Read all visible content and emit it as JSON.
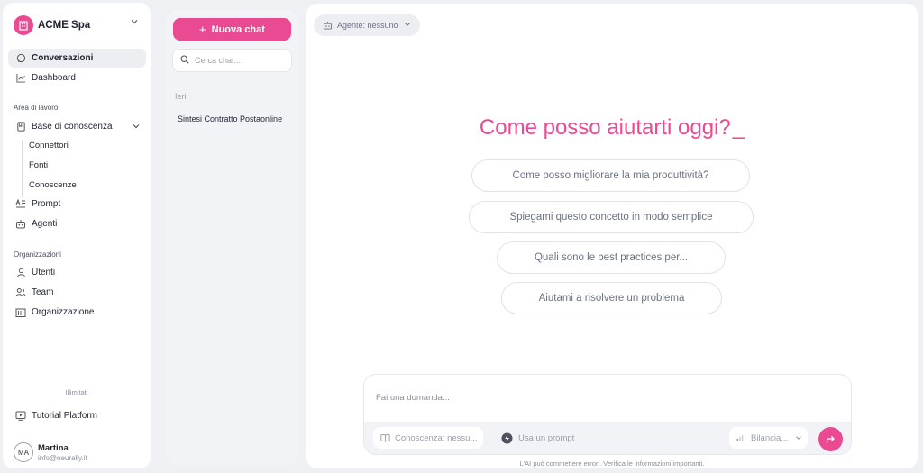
{
  "sidebar": {
    "org_name": "ACME Spa",
    "items": [
      {
        "label": "Conversazioni",
        "icon": "chat-icon"
      },
      {
        "label": "Dashboard",
        "icon": "chart-line-icon"
      }
    ],
    "workspace_section": "Area di lavoro",
    "knowledge": {
      "label": "Base di conoscenza",
      "children": [
        "Connettori",
        "Fonti",
        "Conoscenze"
      ]
    },
    "prompt_label": "Prompt",
    "agents_label": "Agenti",
    "org_section": "Organizzazioni",
    "org_items": [
      "Utenti",
      "Team",
      "Organizzazione"
    ],
    "plan": "Illimitati",
    "tutorial_label": "Tutorial Platform",
    "user": {
      "initials": "MA",
      "name": "Martina",
      "email": "info@neurally.it"
    }
  },
  "chatlist": {
    "new_chat_label": "Nuova chat",
    "search_placeholder": "Cerca chat...",
    "group_label": "Ieri",
    "chats": [
      "Sintesi Contratto Postaonline"
    ]
  },
  "main": {
    "agent_selector": "Agente: nessuno",
    "heading": "Come posso aiutarti oggi?",
    "cursor": "_",
    "suggestions": [
      "Come posso migliorare la mia produttività?",
      "Spiegami questo concetto in modo semplice",
      "Quali sono le best practices per...",
      "Aiutami a risolvere un problema"
    ],
    "composer": {
      "placeholder": "Fai una domanda...",
      "knowledge_chip": "Conoscenza: nessu...",
      "prompt_chip": "Usa un prompt",
      "mode_select": "Bilancia...",
      "disclaimer": "L'AI può commettere errori. Verifica le informazioni importanti."
    }
  },
  "colors": {
    "accent": "#ea4a92",
    "background": "#eef0f3"
  }
}
